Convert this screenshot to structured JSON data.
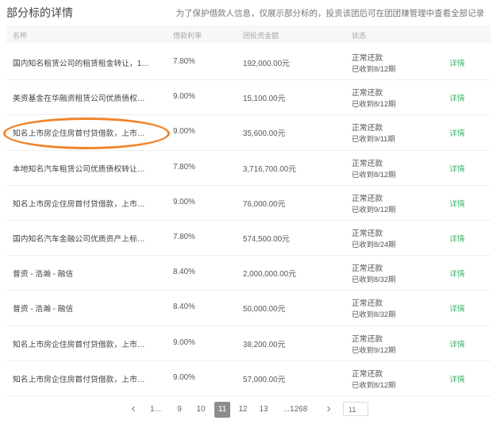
{
  "header": {
    "title": "部分标的详情",
    "notice": "为了保护借款人信息，仅展示部分标的，投资该团后可在团团赚管理中查看全部记录"
  },
  "table": {
    "columns": [
      "名称",
      "借款利率",
      "团投资金额",
      "状态"
    ],
    "rows": [
      {
        "name": "国内知名租赁公司的租赁租金转让，1…",
        "rate": "7.80%",
        "amount": "192,000.00元",
        "status": "正常还款",
        "progress": "已收到8/12期",
        "action": "详情"
      },
      {
        "name": "美资基金在华融资租赁公司优质债权…",
        "rate": "9.00%",
        "amount": "15,100.00元",
        "status": "正常还款",
        "progress": "已收到8/12期",
        "action": "详情"
      },
      {
        "name": "知名上市房企住房首付贷借款，上市…",
        "rate": "9.00%",
        "amount": "35,600.00元",
        "status": "正常还款",
        "progress": "已收到9/11期",
        "action": "详情"
      },
      {
        "name": "本地知名汽车租赁公司优质债权转让…",
        "rate": "7.80%",
        "amount": "3,716,700.00元",
        "status": "正常还款",
        "progress": "已收到8/12期",
        "action": "详情"
      },
      {
        "name": "知名上市房企住房首付贷借款，上市…",
        "rate": "9.00%",
        "amount": "76,000.00元",
        "status": "正常还款",
        "progress": "已收到9/12期",
        "action": "详情"
      },
      {
        "name": "国内知名汽车金融公司优质资产上标…",
        "rate": "7.80%",
        "amount": "574,500.00元",
        "status": "正常还款",
        "progress": "已收到8/24期",
        "action": "详情"
      },
      {
        "name": "普资 - 浩瀚 - 融信",
        "rate": "8.40%",
        "amount": "2,000,000.00元",
        "status": "正常还款",
        "progress": "已收到8/32期",
        "action": "详情"
      },
      {
        "name": "普资 - 浩瀚 - 融信",
        "rate": "8.40%",
        "amount": "50,000.00元",
        "status": "正常还款",
        "progress": "已收到8/32期",
        "action": "详情"
      },
      {
        "name": "知名上市房企住房首付贷借款，上市…",
        "rate": "9.00%",
        "amount": "38,200.00元",
        "status": "正常还款",
        "progress": "已收到9/12期",
        "action": "详情"
      },
      {
        "name": "知名上市房企住房首付贷借款，上市…",
        "rate": "9.00%",
        "amount": "57,000.00元",
        "status": "正常还款",
        "progress": "已收到8/12期",
        "action": "详情"
      }
    ]
  },
  "pagination": {
    "prev": "‹",
    "pages": [
      "1...",
      "9",
      "10",
      "11",
      "12",
      "13",
      "...1268"
    ],
    "current": "11",
    "next": "›",
    "jump_value": "11"
  },
  "colors": {
    "accent_green": "#3cb56b",
    "highlight_orange": "#f0842a",
    "current_page_bg": "#8c8c8c"
  }
}
